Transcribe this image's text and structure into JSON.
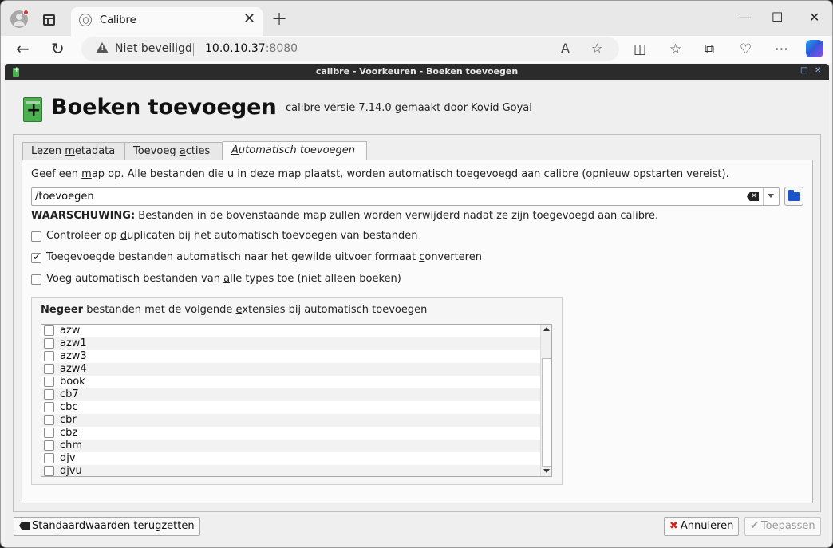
{
  "browser": {
    "tab_title": "Calibre",
    "tab_close": "✕",
    "new_tab": "+",
    "security_label": "Niet beveiligd",
    "url_host": "10.0.10.37",
    "url_port": ":8080",
    "window_minimize": "—",
    "window_maximize": "☐",
    "window_close": "✕"
  },
  "calibre_window": {
    "title": "calibre - Voorkeuren - Boeken toevoegen",
    "btn_maximize": "□",
    "btn_close": "✕"
  },
  "dialog": {
    "heading": "Boeken toevoegen",
    "subheading": "calibre versie 7.14.0 gemaakt door Kovid Goyal",
    "tabs": [
      {
        "label_pre": "Lezen ",
        "label_u": "m",
        "label_post": "etadata"
      },
      {
        "label_pre": "Toevoeg ",
        "label_u": "a",
        "label_post": "cties"
      },
      {
        "label_pre": "",
        "label_u": "A",
        "label_post": "utomatisch toevoegen"
      }
    ],
    "instructions_pre": "Geef een ",
    "instructions_u": "m",
    "instructions_post": "ap op. Alle bestanden die u in deze map plaatst, worden automatisch toegevoegd aan calibre (opnieuw opstarten vereist).",
    "folder_value": "/toevoegen",
    "warning_bold": "WAARSCHUWING:",
    "warning_text": " Bestanden in de bovenstaande map zullen worden verwijderd nadat ze zijn toegevoegd aan calibre.",
    "options": [
      {
        "pre": "Controleer op ",
        "u": "d",
        "post": "uplicaten bij het automatisch toevoegen van bestanden",
        "checked": false
      },
      {
        "pre": "Toegevoegde bestanden automatisch naar het gewilde uitvoer formaat ",
        "u": "c",
        "post": "onverteren",
        "checked": true
      },
      {
        "pre": "Voeg automatisch bestanden van ",
        "u": "a",
        "post": "lle types toe (niet alleen boeken)",
        "checked": false
      }
    ],
    "ignore_bold": "Negeer",
    "ignore_pre": " bestanden met de volgende ",
    "ignore_u": "e",
    "ignore_post": "xtensies bij automatisch toevoegen",
    "extensions": [
      "azw",
      "azw1",
      "azw3",
      "azw4",
      "book",
      "cb7",
      "cbc",
      "cbr",
      "cbz",
      "chm",
      "djv",
      "djvu"
    ],
    "reset_pre": "Stan",
    "reset_u": "d",
    "reset_post": "aardwaarden terugzetten",
    "cancel_label": "Annuleren",
    "apply_label": "Toepassen"
  }
}
